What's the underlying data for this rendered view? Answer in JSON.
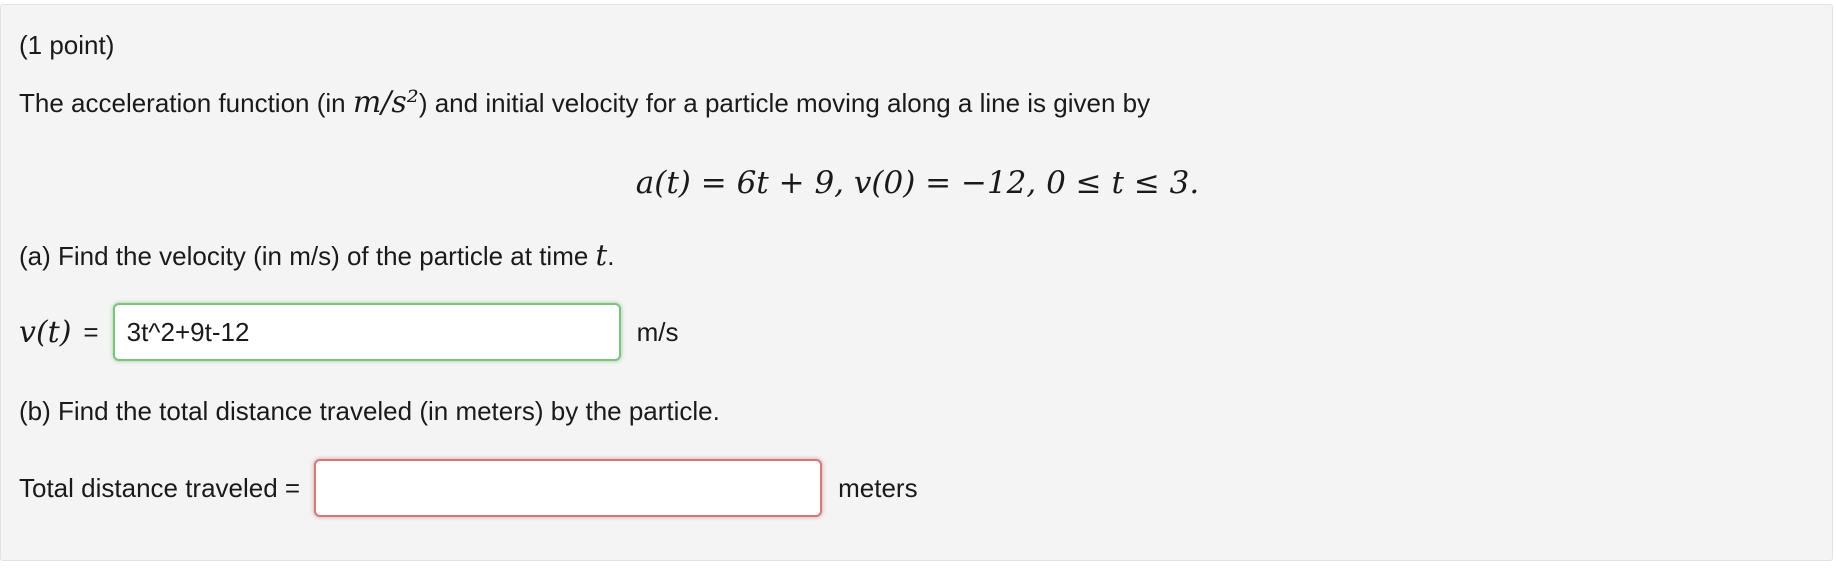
{
  "problem": {
    "points": "(1 point)",
    "intro_prefix": "The acceleration function (in",
    "intro_units": "m/s²",
    "intro_suffix": ") and initial velocity for a particle moving along a line is given by",
    "equation": "a(t) = 6t + 9,  v(0) = −12,  0 ≤ t ≤ 3."
  },
  "part_a": {
    "question_prefix": "(a) Find the velocity (in m/s) of the particle at time",
    "question_var": "t",
    "question_suffix": ".",
    "label": "v(t)",
    "equals": "=",
    "value": "3t^2+9t-12",
    "unit": "m/s",
    "status_color": "#7cc27c"
  },
  "part_b": {
    "question": "(b) Find the total distance traveled (in meters) by the particle.",
    "label": "Total distance traveled =",
    "value": "",
    "unit": "meters",
    "status_color": "#d27a7a"
  }
}
